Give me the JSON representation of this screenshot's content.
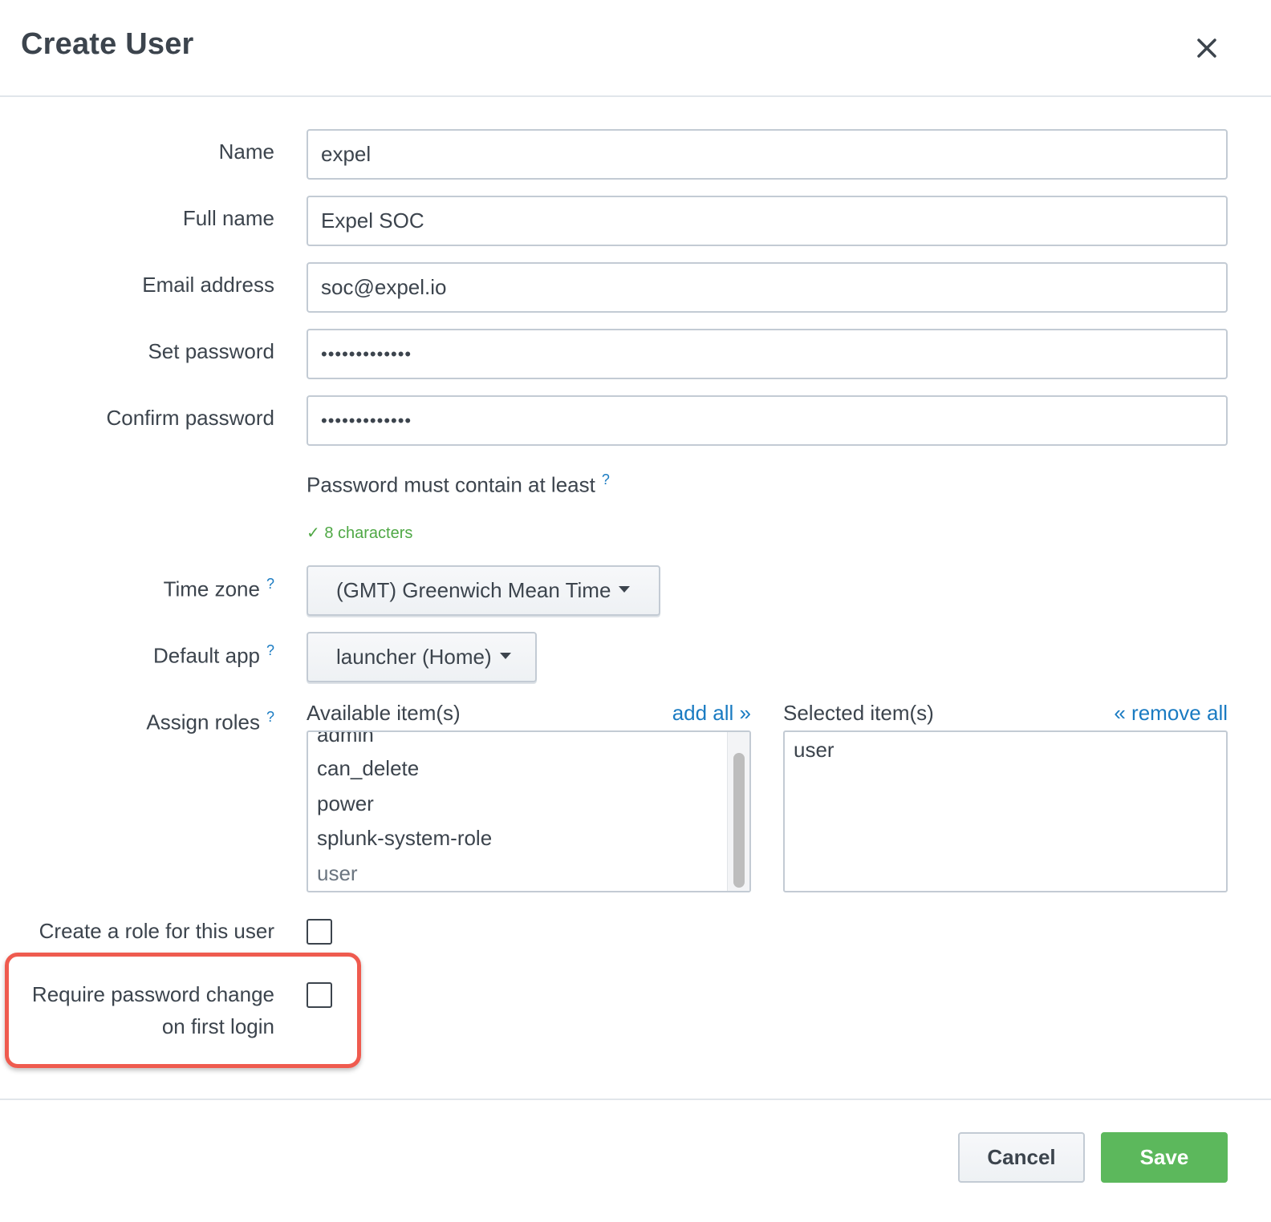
{
  "dialog": {
    "title": "Create User"
  },
  "fields": {
    "name": {
      "label": "Name",
      "value": "expel"
    },
    "full_name": {
      "label": "Full name",
      "value": "Expel SOC"
    },
    "email": {
      "label": "Email address",
      "value": "soc@expel.io"
    },
    "set_password": {
      "label": "Set password",
      "value": "•••••••••••••"
    },
    "confirm_password": {
      "label": "Confirm password",
      "value": "•••••••••••••"
    }
  },
  "password_rules": {
    "hint": "Password must contain at least",
    "help": "?",
    "rule": "✓ 8 characters",
    "rule_color": "#4fa845"
  },
  "time_zone": {
    "label": "Time zone",
    "help": "?",
    "value": "(GMT) Greenwich Mean Time"
  },
  "default_app": {
    "label": "Default app",
    "help": "?",
    "value": "launcher (Home)"
  },
  "roles": {
    "label": "Assign roles",
    "help": "?",
    "available_title": "Available item(s)",
    "add_all": "add all »",
    "selected_title": "Selected item(s)",
    "remove_all": "« remove all",
    "available": [
      "admin",
      "can_delete",
      "power",
      "splunk-system-role",
      "user"
    ],
    "selected": [
      "user"
    ]
  },
  "create_role": {
    "label": "Create a role for this user",
    "checked": false
  },
  "require_pw_change": {
    "label_line1": "Require password change",
    "label_line2": "on first login",
    "checked": false
  },
  "buttons": {
    "cancel": "Cancel",
    "save": "Save"
  },
  "colors": {
    "accent_link": "#1a7bc2",
    "save": "#5cb85c",
    "highlight": "#ef5b4f"
  },
  "icons": {
    "close": "close-icon"
  }
}
